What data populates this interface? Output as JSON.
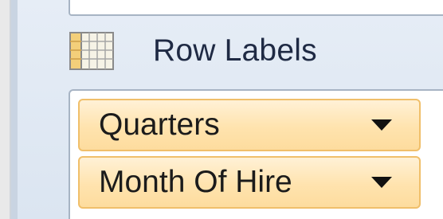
{
  "row_labels_section": {
    "label": "Row Labels",
    "icon": "row-labels-grid-icon"
  },
  "fields": [
    {
      "label": "Quarters",
      "icon": "dropdown-arrow-icon"
    },
    {
      "label": "Month Of Hire",
      "icon": "dropdown-arrow-icon"
    }
  ],
  "colors": {
    "pane_background": "#dbe5f1",
    "field_fill": "#ffe3ae",
    "field_border": "#f0bf6a",
    "box_border": "#a7b4c4",
    "label_text": "#1f2a44"
  }
}
